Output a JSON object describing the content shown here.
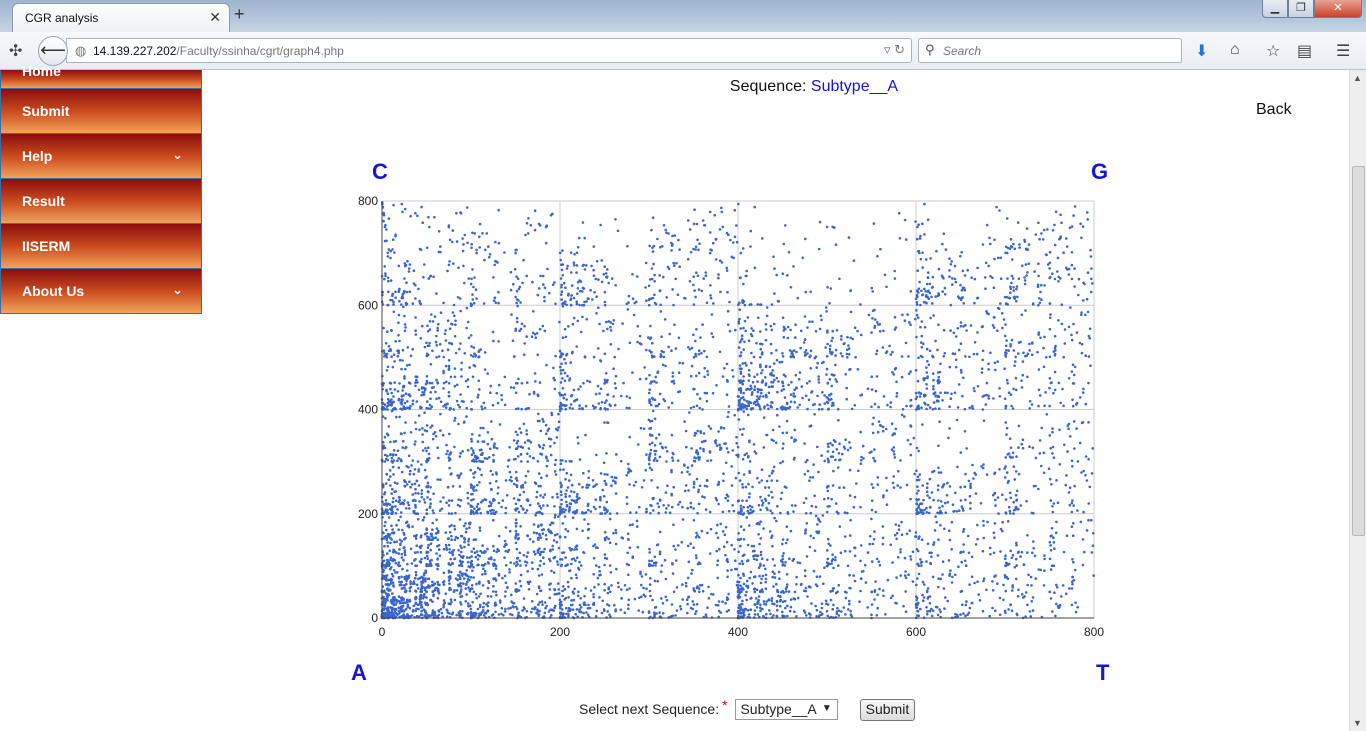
{
  "browser": {
    "tab_title": "CGR analysis",
    "tab_close": "✕",
    "new_tab": "+",
    "url_host": "14.139.227.202",
    "url_path": "/Faculty/ssinha/cgrt/graph4.php",
    "search_placeholder": "Search",
    "window_min": "▁",
    "window_max": "❐",
    "window_close": "✕"
  },
  "sidebar": {
    "items": [
      {
        "label": "Home",
        "has_chevron": false
      },
      {
        "label": "Submit",
        "has_chevron": false
      },
      {
        "label": "Help",
        "has_chevron": true
      },
      {
        "label": "Result",
        "has_chevron": false
      },
      {
        "label": "IISERM",
        "has_chevron": false
      },
      {
        "label": "About Us",
        "has_chevron": true
      }
    ],
    "chevron": "⌄"
  },
  "page": {
    "sequence_label": "Sequence:",
    "sequence_name": "Subtype__A",
    "back_label": "Back",
    "corners": {
      "top_left": "C",
      "top_right": "G",
      "bottom_left": "A",
      "bottom_right": "T"
    },
    "form": {
      "label": "Select next Sequence:",
      "required_mark": "*",
      "selected_option": "Subtype__A",
      "submit_label": "Submit"
    }
  },
  "colors": {
    "point_color": "#3a66cc",
    "corner_color": "#1515d6",
    "grid_color": "#cccccc"
  },
  "chart_data": {
    "type": "scatter",
    "title": "",
    "xlabel": "",
    "ylabel": "",
    "xlim": [
      0,
      800
    ],
    "ylim": [
      0,
      800
    ],
    "xticks": [
      0,
      200,
      400,
      600,
      800
    ],
    "yticks": [
      0,
      200,
      400,
      600,
      800
    ],
    "grid": true,
    "series": [
      {
        "note_density_by_region": "Chaos game representation of a DNA sequence; ~6000 points with dense clusters along the lower-left diagonal (A/C region), in the C-G middle quadrant (400-600, 400-600) and the G corner (600-800, 600-800)",
        "point_count_estimate": 6000
      }
    ]
  }
}
